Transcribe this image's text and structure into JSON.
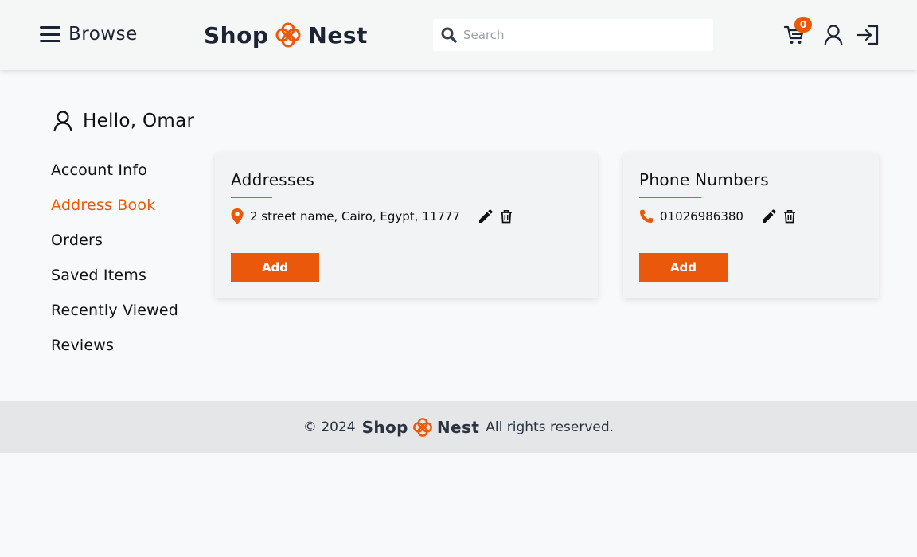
{
  "header": {
    "browse_label": "Browse",
    "logo": {
      "left_word": "Shop",
      "right_word": "Nest"
    },
    "search": {
      "placeholder": "Search",
      "value": ""
    },
    "cart": {
      "count": "0"
    }
  },
  "greeting": {
    "text": "Hello, Omar"
  },
  "sidebar": {
    "items": [
      {
        "label": "Account Info",
        "active": false
      },
      {
        "label": "Address Book",
        "active": true
      },
      {
        "label": "Orders",
        "active": false
      },
      {
        "label": "Saved Items",
        "active": false
      },
      {
        "label": "Recently Viewed",
        "active": false
      },
      {
        "label": "Reviews",
        "active": false
      }
    ]
  },
  "addresses": {
    "title": "Addresses",
    "items": [
      {
        "text": "2 street name, Cairo, Egypt, 11777"
      }
    ],
    "add_label": "Add"
  },
  "phones": {
    "title": "Phone Numbers",
    "items": [
      {
        "text": "01026986380"
      }
    ],
    "add_label": "Add"
  },
  "footer": {
    "copyright": "© 2024",
    "logo_left": "Shop",
    "logo_right": "Nest",
    "rights": "All rights reserved."
  },
  "colors": {
    "accent": "#ea580c",
    "text": "#1c2333",
    "footer_bg": "#e5e6e8"
  },
  "icons": [
    "menu-icon",
    "logo-flower-icon",
    "search-icon",
    "cart-icon",
    "user-icon",
    "login-icon",
    "location-pin-icon",
    "phone-icon",
    "pencil-icon",
    "trash-icon"
  ]
}
